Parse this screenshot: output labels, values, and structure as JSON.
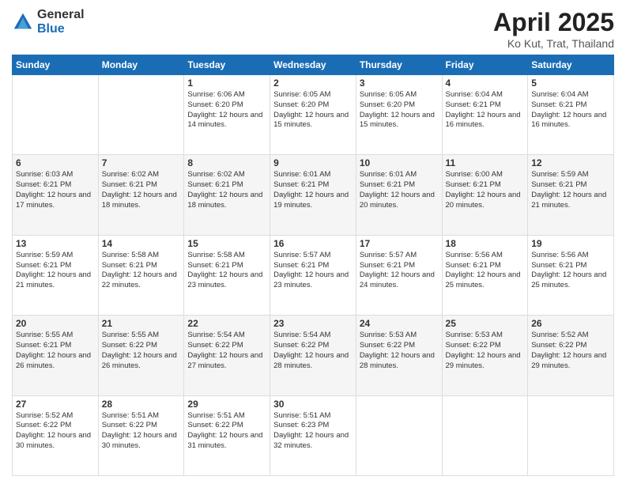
{
  "header": {
    "logo_general": "General",
    "logo_blue": "Blue",
    "title": "April 2025",
    "location": "Ko Kut, Trat, Thailand"
  },
  "weekdays": [
    "Sunday",
    "Monday",
    "Tuesday",
    "Wednesday",
    "Thursday",
    "Friday",
    "Saturday"
  ],
  "weeks": [
    [
      {
        "day": "",
        "detail": ""
      },
      {
        "day": "",
        "detail": ""
      },
      {
        "day": "1",
        "detail": "Sunrise: 6:06 AM\nSunset: 6:20 PM\nDaylight: 12 hours and 14 minutes."
      },
      {
        "day": "2",
        "detail": "Sunrise: 6:05 AM\nSunset: 6:20 PM\nDaylight: 12 hours and 15 minutes."
      },
      {
        "day": "3",
        "detail": "Sunrise: 6:05 AM\nSunset: 6:20 PM\nDaylight: 12 hours and 15 minutes."
      },
      {
        "day": "4",
        "detail": "Sunrise: 6:04 AM\nSunset: 6:21 PM\nDaylight: 12 hours and 16 minutes."
      },
      {
        "day": "5",
        "detail": "Sunrise: 6:04 AM\nSunset: 6:21 PM\nDaylight: 12 hours and 16 minutes."
      }
    ],
    [
      {
        "day": "6",
        "detail": "Sunrise: 6:03 AM\nSunset: 6:21 PM\nDaylight: 12 hours and 17 minutes."
      },
      {
        "day": "7",
        "detail": "Sunrise: 6:02 AM\nSunset: 6:21 PM\nDaylight: 12 hours and 18 minutes."
      },
      {
        "day": "8",
        "detail": "Sunrise: 6:02 AM\nSunset: 6:21 PM\nDaylight: 12 hours and 18 minutes."
      },
      {
        "day": "9",
        "detail": "Sunrise: 6:01 AM\nSunset: 6:21 PM\nDaylight: 12 hours and 19 minutes."
      },
      {
        "day": "10",
        "detail": "Sunrise: 6:01 AM\nSunset: 6:21 PM\nDaylight: 12 hours and 20 minutes."
      },
      {
        "day": "11",
        "detail": "Sunrise: 6:00 AM\nSunset: 6:21 PM\nDaylight: 12 hours and 20 minutes."
      },
      {
        "day": "12",
        "detail": "Sunrise: 5:59 AM\nSunset: 6:21 PM\nDaylight: 12 hours and 21 minutes."
      }
    ],
    [
      {
        "day": "13",
        "detail": "Sunrise: 5:59 AM\nSunset: 6:21 PM\nDaylight: 12 hours and 21 minutes."
      },
      {
        "day": "14",
        "detail": "Sunrise: 5:58 AM\nSunset: 6:21 PM\nDaylight: 12 hours and 22 minutes."
      },
      {
        "day": "15",
        "detail": "Sunrise: 5:58 AM\nSunset: 6:21 PM\nDaylight: 12 hours and 23 minutes."
      },
      {
        "day": "16",
        "detail": "Sunrise: 5:57 AM\nSunset: 6:21 PM\nDaylight: 12 hours and 23 minutes."
      },
      {
        "day": "17",
        "detail": "Sunrise: 5:57 AM\nSunset: 6:21 PM\nDaylight: 12 hours and 24 minutes."
      },
      {
        "day": "18",
        "detail": "Sunrise: 5:56 AM\nSunset: 6:21 PM\nDaylight: 12 hours and 25 minutes."
      },
      {
        "day": "19",
        "detail": "Sunrise: 5:56 AM\nSunset: 6:21 PM\nDaylight: 12 hours and 25 minutes."
      }
    ],
    [
      {
        "day": "20",
        "detail": "Sunrise: 5:55 AM\nSunset: 6:21 PM\nDaylight: 12 hours and 26 minutes."
      },
      {
        "day": "21",
        "detail": "Sunrise: 5:55 AM\nSunset: 6:22 PM\nDaylight: 12 hours and 26 minutes."
      },
      {
        "day": "22",
        "detail": "Sunrise: 5:54 AM\nSunset: 6:22 PM\nDaylight: 12 hours and 27 minutes."
      },
      {
        "day": "23",
        "detail": "Sunrise: 5:54 AM\nSunset: 6:22 PM\nDaylight: 12 hours and 28 minutes."
      },
      {
        "day": "24",
        "detail": "Sunrise: 5:53 AM\nSunset: 6:22 PM\nDaylight: 12 hours and 28 minutes."
      },
      {
        "day": "25",
        "detail": "Sunrise: 5:53 AM\nSunset: 6:22 PM\nDaylight: 12 hours and 29 minutes."
      },
      {
        "day": "26",
        "detail": "Sunrise: 5:52 AM\nSunset: 6:22 PM\nDaylight: 12 hours and 29 minutes."
      }
    ],
    [
      {
        "day": "27",
        "detail": "Sunrise: 5:52 AM\nSunset: 6:22 PM\nDaylight: 12 hours and 30 minutes."
      },
      {
        "day": "28",
        "detail": "Sunrise: 5:51 AM\nSunset: 6:22 PM\nDaylight: 12 hours and 30 minutes."
      },
      {
        "day": "29",
        "detail": "Sunrise: 5:51 AM\nSunset: 6:22 PM\nDaylight: 12 hours and 31 minutes."
      },
      {
        "day": "30",
        "detail": "Sunrise: 5:51 AM\nSunset: 6:23 PM\nDaylight: 12 hours and 32 minutes."
      },
      {
        "day": "",
        "detail": ""
      },
      {
        "day": "",
        "detail": ""
      },
      {
        "day": "",
        "detail": ""
      }
    ]
  ]
}
